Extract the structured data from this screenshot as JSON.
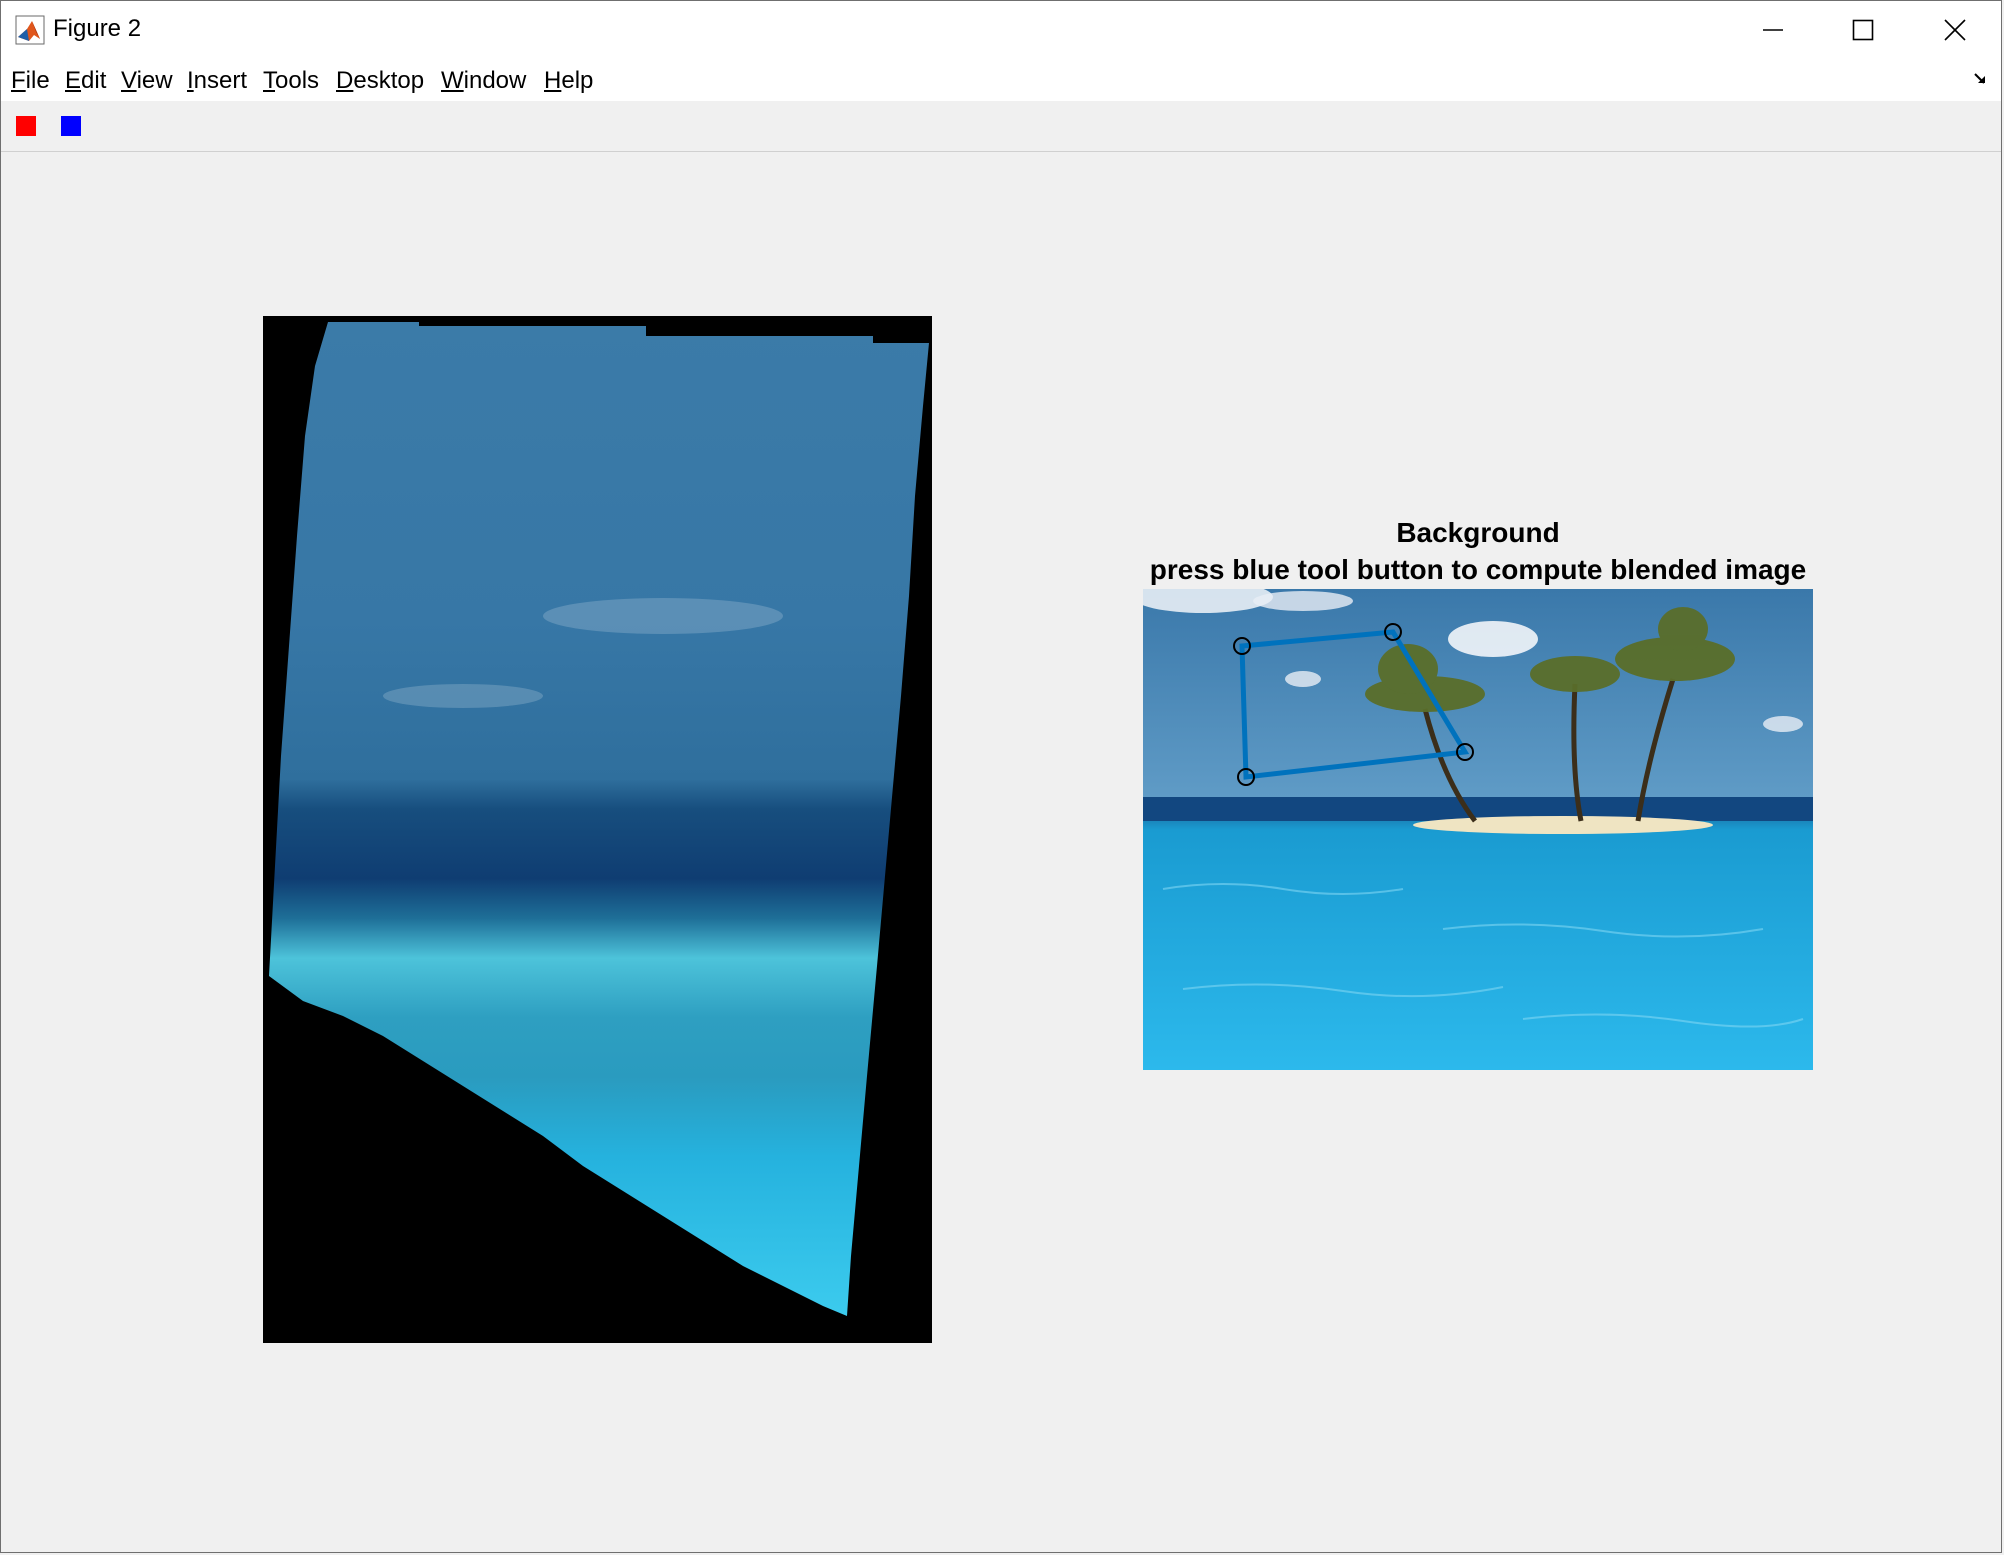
{
  "window": {
    "title": "Figure 2"
  },
  "menu": {
    "items": [
      {
        "label": "File",
        "mnemonic": "F"
      },
      {
        "label": "Edit",
        "mnemonic": "E"
      },
      {
        "label": "View",
        "mnemonic": "V"
      },
      {
        "label": "Insert",
        "mnemonic": "I"
      },
      {
        "label": "Tools",
        "mnemonic": "T"
      },
      {
        "label": "Desktop",
        "mnemonic": "D"
      },
      {
        "label": "Window",
        "mnemonic": "W"
      },
      {
        "label": "Help",
        "mnemonic": "H"
      }
    ]
  },
  "toolbar": {
    "buttons": [
      {
        "name": "red-tool",
        "color": "#ff0000"
      },
      {
        "name": "blue-tool",
        "color": "#0000ff"
      }
    ]
  },
  "right_axes": {
    "title_line1": "Background",
    "title_line2": "press blue tool button to compute blended image",
    "polygon_color": "#0072bd"
  },
  "colors": {
    "figure_bg": "#f0f0f0",
    "ocean_deep": "#0b3e6e",
    "ocean_shallow": "#2ab4e0",
    "sky": "#3a7ba8"
  }
}
